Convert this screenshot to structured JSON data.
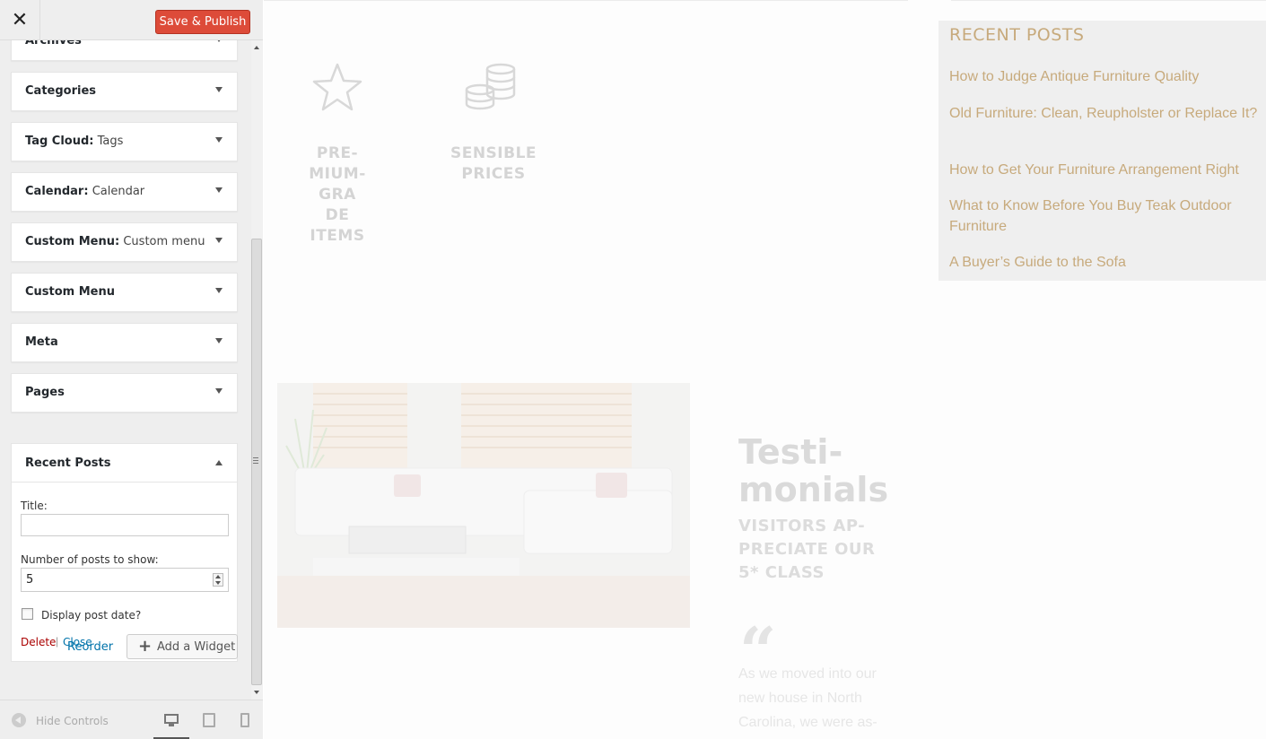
{
  "customizer": {
    "close_label": "✕",
    "publish_label": "Save & Publish",
    "widgets": [
      {
        "name": "Archives",
        "sub": ""
      },
      {
        "name": "Categories",
        "sub": ""
      },
      {
        "name": "Tag Cloud",
        "sub": "Tags"
      },
      {
        "name": "Calendar",
        "sub": "Calendar"
      },
      {
        "name": "Custom Menu",
        "sub": "Custom menu"
      },
      {
        "name": "Custom Menu",
        "sub": ""
      },
      {
        "name": "Meta",
        "sub": ""
      },
      {
        "name": "Pages",
        "sub": ""
      }
    ],
    "recent_posts_widget": {
      "name": "Recent Posts",
      "title_label": "Title:",
      "title_value": "",
      "number_label": "Number of posts to show:",
      "number_value": "5",
      "display_date_label": "Display post date?",
      "display_date_checked": false,
      "delete_label": "Delete",
      "separator": "|",
      "close_label": "Close"
    },
    "reorder_label": "Reorder",
    "add_widget_label": "Add a Widget",
    "add_widget_icon": "plus-icon",
    "footer": {
      "hide_controls_label": "Hide Controls",
      "devices": [
        "desktop-icon",
        "tablet-icon",
        "mobile-icon"
      ],
      "active_device": "desktop"
    }
  },
  "preview": {
    "features": [
      {
        "icon": "star-icon",
        "label": "PRE-\nMIUM-GRA\nDE\nITEMS"
      },
      {
        "icon": "coins-icon",
        "label": "SENSIBLE\nPRICES"
      }
    ],
    "recent_posts": {
      "heading": "RECENT POSTS",
      "links": [
        "How to Judge Antique Furniture Quality",
        "Old Furniture: Clean, Reupholster or Replace It?",
        "How to Get Your Furniture Arrangement Right",
        "What to Know Before You Buy Teak Outdoor Furniture",
        "A Buyer’s Guide to the Sofa"
      ]
    },
    "testimonials": {
      "title": "Testi-\nmonials",
      "subtitle": "VISITORS AP-\nPRECIATE OUR\n5* CLASS",
      "quote_glyph": "“",
      "text": "As we moved into our new house in North Carolina, we were as-"
    }
  },
  "colors": {
    "publish": "#dd4b39",
    "link": "#0073aa",
    "delete": "#aa0000",
    "accent_gold": "#c7aa7c"
  }
}
